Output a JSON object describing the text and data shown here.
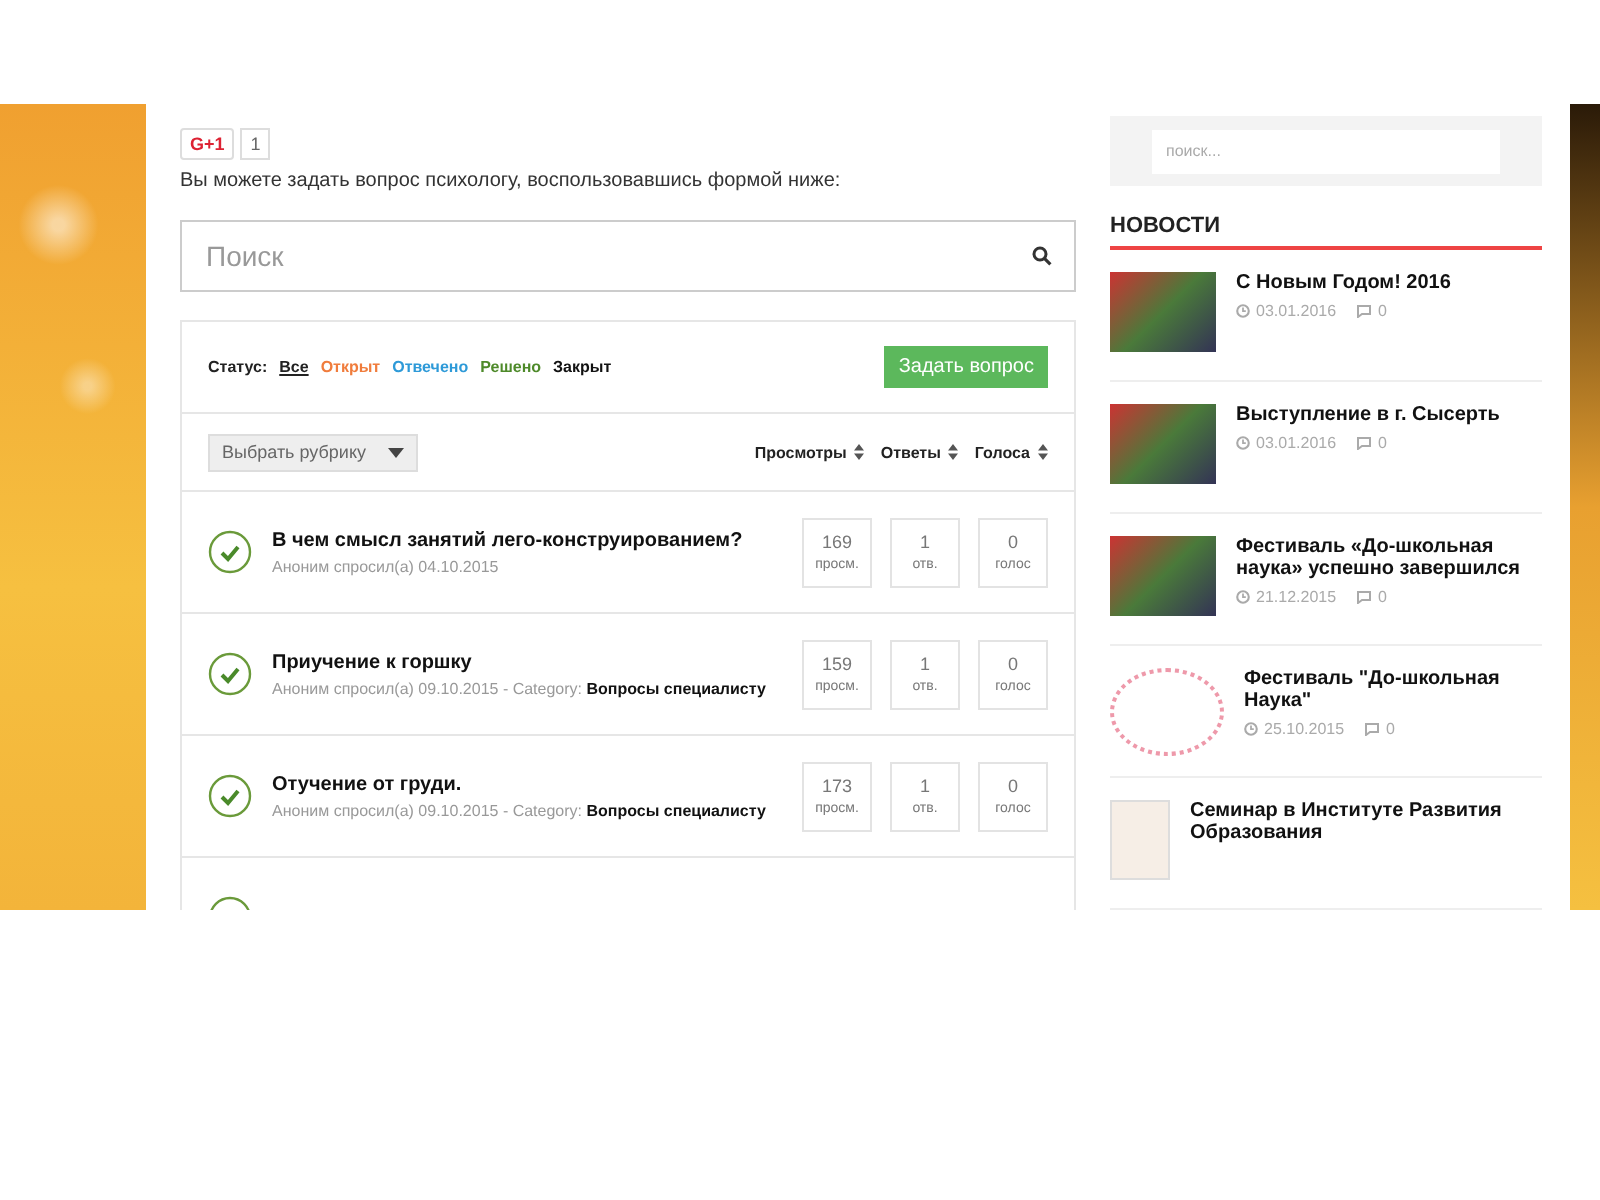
{
  "gplus": {
    "label": "G+1",
    "count": "1"
  },
  "intro": "Вы можете задать вопрос психологу, воспользовавшись формой ниже:",
  "search": {
    "placeholder": "Поиск"
  },
  "status_filter": {
    "label": "Статус:",
    "items": [
      {
        "label": "Все",
        "selected": true,
        "color": "#222222"
      },
      {
        "label": "Открыт",
        "selected": false,
        "color": "#f07c3c"
      },
      {
        "label": "Отвечено",
        "selected": false,
        "color": "#2e9ad8"
      },
      {
        "label": "Решено",
        "selected": false,
        "color": "#4e8a2a"
      },
      {
        "label": "Закрыт",
        "selected": false,
        "color": "#111111"
      }
    ]
  },
  "ask_button": "Задать вопрос",
  "category_select": "Выбрать рубрику",
  "sort_columns": [
    "Просмотры",
    "Ответы",
    "Голоса"
  ],
  "questions": [
    {
      "title": "В чем смысл занятий лего-конструированием?",
      "meta": "Аноним спросил(а) 04.10.2015",
      "resolved": true,
      "stats": [
        {
          "value": "169",
          "unit": "просм."
        },
        {
          "value": "1",
          "unit": "отв."
        },
        {
          "value": "0",
          "unit": "голос"
        }
      ]
    },
    {
      "title": "Приучение к горшку",
      "meta": "Аноним спросил(а) 09.10.2015  -  Category:",
      "category": "Вопросы специалисту",
      "resolved": true,
      "stats": [
        {
          "value": "159",
          "unit": "просм."
        },
        {
          "value": "1",
          "unit": "отв."
        },
        {
          "value": "0",
          "unit": "голос"
        }
      ]
    },
    {
      "title": "Отучение от груди.",
      "meta": "Аноним спросил(а) 09.10.2015  -  Category:",
      "category": "Вопросы специалисту",
      "resolved": true,
      "stats": [
        {
          "value": "173",
          "unit": "просм."
        },
        {
          "value": "1",
          "unit": "отв."
        },
        {
          "value": "0",
          "unit": "голос"
        }
      ]
    },
    {
      "resolved": true
    }
  ],
  "sidebar": {
    "search": {
      "placeholder": "поиск..."
    },
    "news_heading": "НОВОСТИ",
    "news": [
      {
        "title": "С Новым Годом! 2016",
        "date": "03.01.2016",
        "comments": "0",
        "kind": "photo"
      },
      {
        "title": "Выступление в г. Сысерть",
        "date": "03.01.2016",
        "comments": "0",
        "kind": "photo"
      },
      {
        "title": "Фестиваль «До-школьная наука» успешно завершился",
        "date": "21.12.2015",
        "comments": "0",
        "kind": "photo"
      },
      {
        "title": "Фестиваль \"До-школьная Наука\"",
        "date": "25.10.2015",
        "comments": "0",
        "kind": "drawing"
      },
      {
        "title": "Семинар в Институте Развития Образования",
        "kind": "document"
      }
    ]
  }
}
